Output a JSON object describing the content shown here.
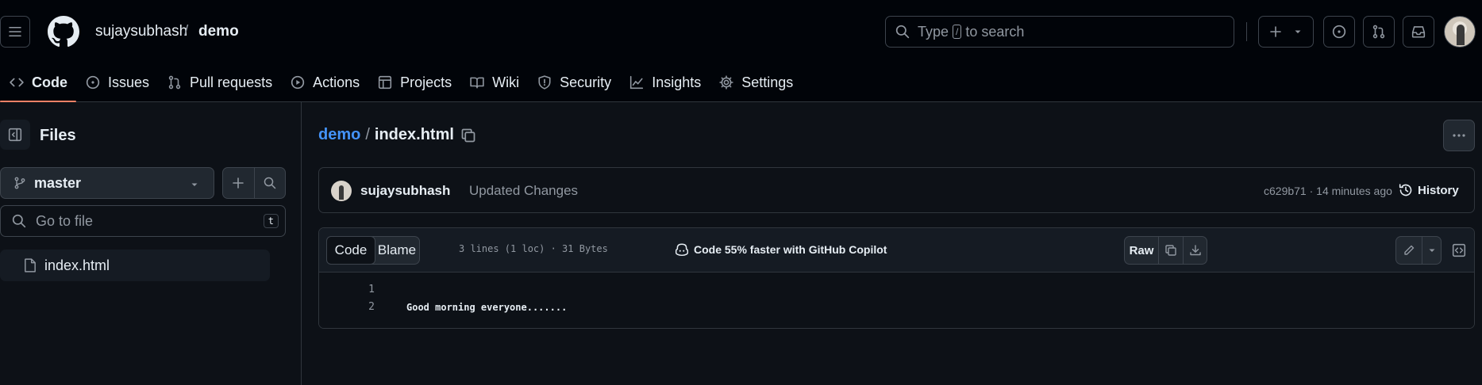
{
  "header": {
    "owner": "sujaysubhash",
    "separator": "/",
    "repo": "demo",
    "search_prefix": "Type",
    "search_key": "/",
    "search_suffix": "to search"
  },
  "repo_nav": [
    {
      "label": "Code",
      "icon": "code-icon",
      "active": true
    },
    {
      "label": "Issues",
      "icon": "issue-icon"
    },
    {
      "label": "Pull requests",
      "icon": "pull-request-icon"
    },
    {
      "label": "Actions",
      "icon": "play-icon"
    },
    {
      "label": "Projects",
      "icon": "table-icon"
    },
    {
      "label": "Wiki",
      "icon": "book-icon"
    },
    {
      "label": "Security",
      "icon": "shield-icon"
    },
    {
      "label": "Insights",
      "icon": "graph-icon"
    },
    {
      "label": "Settings",
      "icon": "gear-icon"
    }
  ],
  "sidebar": {
    "title": "Files",
    "branch": "master",
    "goto_placeholder": "Go to file",
    "goto_key": "t",
    "files": [
      {
        "name": "index.html"
      }
    ]
  },
  "main": {
    "path_repo": "demo",
    "path_sep": "/",
    "path_file": "index.html",
    "commit": {
      "author": "sujaysubhash",
      "message": "Updated Changes",
      "meta": "c629b71 · 14 minutes ago",
      "history_label": "History"
    },
    "code_toolbar": {
      "tab_code": "Code",
      "tab_blame": "Blame",
      "meta": "3 lines (1 loc) · 31 Bytes",
      "copilot": "Code 55% faster with GitHub Copilot",
      "raw_label": "Raw"
    },
    "lines": [
      {
        "number": "1",
        "text": ""
      },
      {
        "number": "2",
        "text": "Good morning everyone......."
      }
    ]
  },
  "colors": {
    "accent_link": "#4493f8",
    "active_underline": "#f78166",
    "bg": "#0d1117",
    "header_bg": "#010409"
  }
}
